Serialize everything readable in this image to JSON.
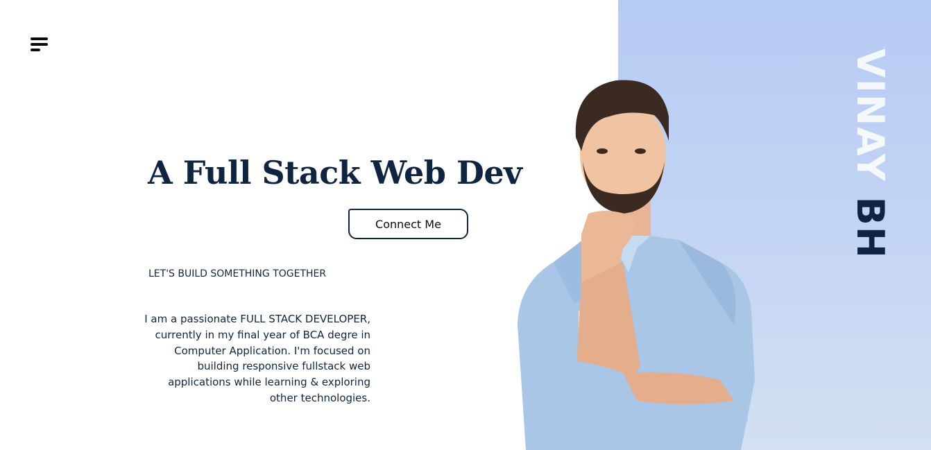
{
  "nav": {
    "menu_icon": "hamburger-menu-icon"
  },
  "hero": {
    "title": "A Full Stack Web Dev",
    "connect_label": "Connect Me",
    "tagline": "LET'S BUILD SOMETHING TOGETHER",
    "intro_lines": [
      "I am a passionate FULL STACK DEVELOPER,",
      "currently in my final year of BCA degre in",
      "Computer Application. I'm focused on",
      "building responsive fullstack web",
      "applications while learning & exploring",
      "other technologies."
    ]
  },
  "brand": {
    "first_name": "VINAY",
    "last_name": "BH"
  },
  "portrait": {
    "subject": "illustrated-developer-portrait"
  },
  "colors": {
    "text_dark": "#0f2440",
    "panel_top": "#b6cbf4",
    "panel_bottom": "#d3e0f3",
    "background": "#ffffff"
  }
}
